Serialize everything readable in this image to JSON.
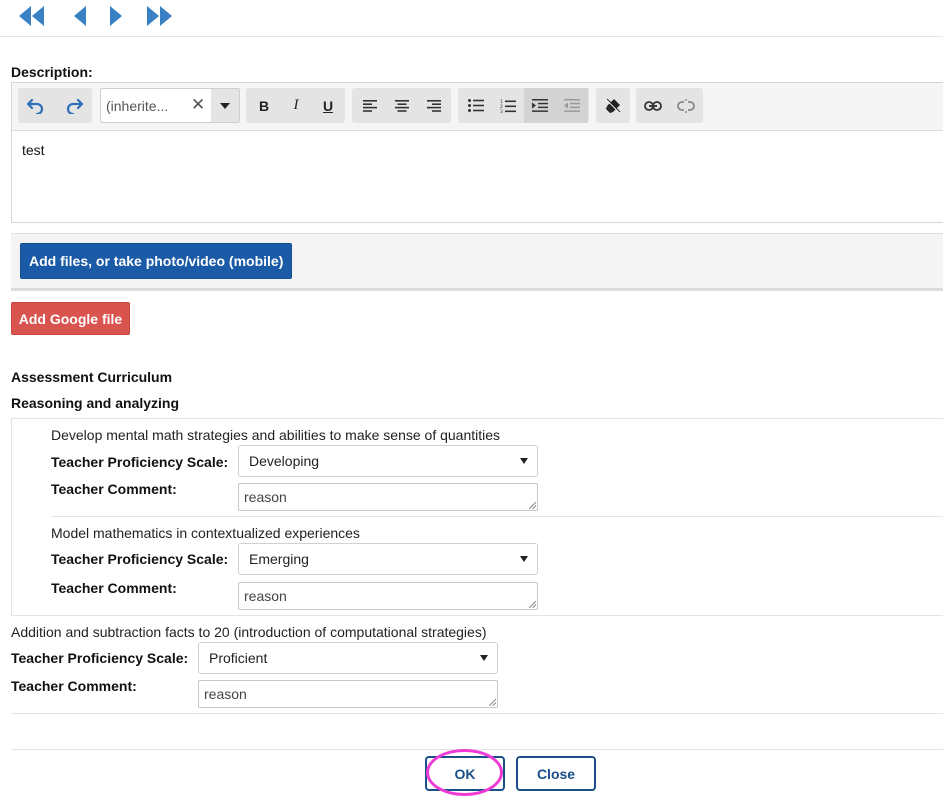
{
  "nav": {
    "first_icon": "double-chevron-left-icon",
    "prev_icon": "triangle-left-icon",
    "next_icon": "triangle-right-icon",
    "last_icon": "double-chevron-right-icon",
    "icon_color": "#3a80c5"
  },
  "description": {
    "label": "Description:",
    "editor": {
      "toolbar": {
        "undo_icon": "undo-icon",
        "redo_icon": "redo-icon",
        "format_value": "(inherite...",
        "clear_icon": "close-icon",
        "dropdown_icon": "caret-down-icon",
        "bold_label": "B",
        "italic_label": "I",
        "underline_label": "U",
        "align_icons": [
          "align-left-icon",
          "align-center-icon",
          "align-right-icon"
        ],
        "list_icons": [
          "bullet-list-icon",
          "numbered-list-icon",
          "indent-icon",
          "outdent-icon"
        ],
        "clear_format_icon": "eraser-icon",
        "link_icons": [
          "link-icon",
          "unlink-icon"
        ]
      },
      "content": "test"
    }
  },
  "attachments": {
    "add_files_label": "Add files, or take photo/video (mobile)",
    "add_google_label": "Add Google file"
  },
  "curriculum": {
    "title": "Assessment Curriculum",
    "group_title": "Reasoning and analyzing",
    "nested": [
      {
        "name": "Develop mental math strategies and abilities to make sense of quantities",
        "scale_label": "Teacher Proficiency Scale:",
        "scale_value": "Developing",
        "comment_label": "Teacher Comment:",
        "comment_value": "reason"
      },
      {
        "name": "Model mathematics in contextualized experiences",
        "scale_label": "Teacher Proficiency Scale:",
        "scale_value": "Emerging",
        "comment_label": "Teacher Comment:",
        "comment_value": "reason"
      }
    ],
    "standalone": {
      "name": "Addition and subtraction facts to 20 (introduction of computational strategies)",
      "scale_label": "Teacher Proficiency Scale:",
      "scale_value": "Proficient",
      "comment_label": "Teacher Comment:",
      "comment_value": "reason"
    }
  },
  "footer": {
    "ok_label": "OK",
    "close_label": "Close",
    "highlight_color": "#ee3bd6"
  },
  "colors": {
    "primary": "#1b5aa6",
    "danger": "#d9534f",
    "outline": "#1b4f8a"
  }
}
